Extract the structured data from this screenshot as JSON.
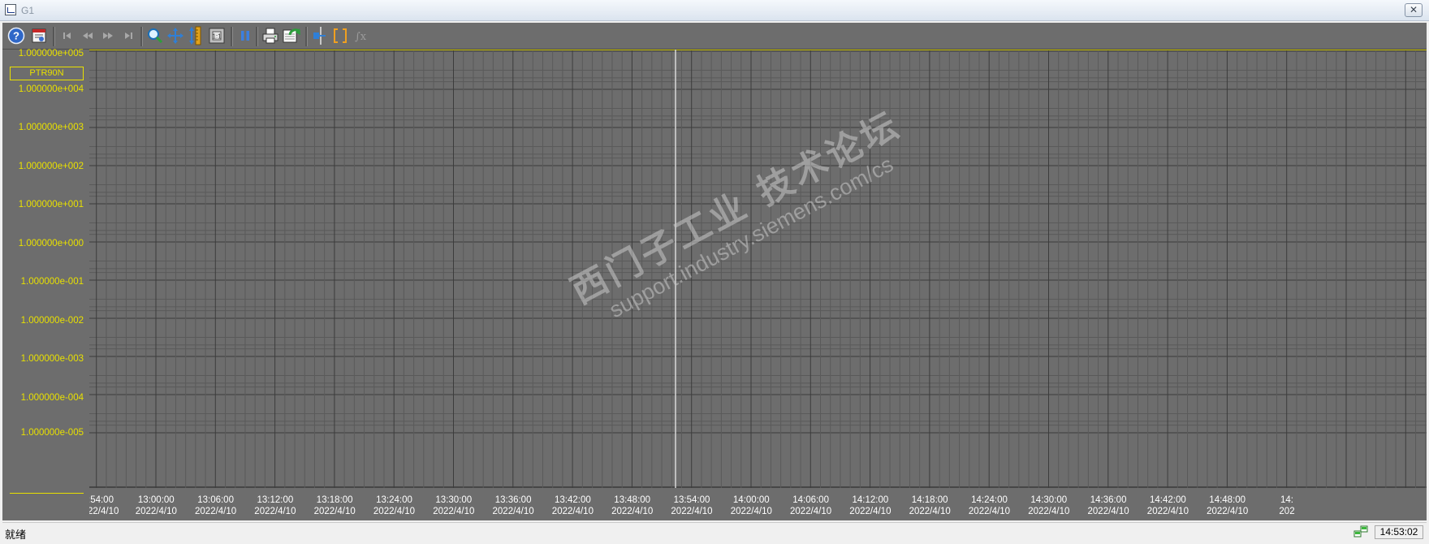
{
  "window": {
    "title": "G1",
    "close_glyph": "✕"
  },
  "toolbar": {
    "buttons": [
      {
        "name": "help-icon"
      },
      {
        "name": "config-icon"
      },
      {
        "name": "first-icon"
      },
      {
        "name": "prev-icon"
      },
      {
        "name": "next-icon"
      },
      {
        "name": "last-icon"
      },
      {
        "name": "zoom-icon"
      },
      {
        "name": "pan-icon"
      },
      {
        "name": "ruler-icon"
      },
      {
        "name": "original-view-icon"
      },
      {
        "name": "pause-icon"
      },
      {
        "name": "print-icon"
      },
      {
        "name": "export-icon"
      },
      {
        "name": "cursor-icon"
      },
      {
        "name": "brackets-icon"
      },
      {
        "name": "statistics-icon"
      }
    ]
  },
  "trace": {
    "name": "PTR90N",
    "color": "#e8e000"
  },
  "y_axis": {
    "scale": "log",
    "labels": [
      "1.000000e+005",
      "1.000000e+004",
      "1.000000e+003",
      "1.000000e+002",
      "1.000000e+001",
      "1.000000e+000",
      "1.000000e-001",
      "1.000000e-002",
      "1.000000e-003",
      "1.000000e-004",
      "1.000000e-005"
    ]
  },
  "x_axis": {
    "ticks": [
      {
        "time": ":54:00",
        "date": "22/4/10"
      },
      {
        "time": "13:00:00",
        "date": "2022/4/10"
      },
      {
        "time": "13:06:00",
        "date": "2022/4/10"
      },
      {
        "time": "13:12:00",
        "date": "2022/4/10"
      },
      {
        "time": "13:18:00",
        "date": "2022/4/10"
      },
      {
        "time": "13:24:00",
        "date": "2022/4/10"
      },
      {
        "time": "13:30:00",
        "date": "2022/4/10"
      },
      {
        "time": "13:36:00",
        "date": "2022/4/10"
      },
      {
        "time": "13:42:00",
        "date": "2022/4/10"
      },
      {
        "time": "13:48:00",
        "date": "2022/4/10"
      },
      {
        "time": "13:54:00",
        "date": "2022/4/10"
      },
      {
        "time": "14:00:00",
        "date": "2022/4/10"
      },
      {
        "time": "14:06:00",
        "date": "2022/4/10"
      },
      {
        "time": "14:12:00",
        "date": "2022/4/10"
      },
      {
        "time": "14:18:00",
        "date": "2022/4/10"
      },
      {
        "time": "14:24:00",
        "date": "2022/4/10"
      },
      {
        "time": "14:30:00",
        "date": "2022/4/10"
      },
      {
        "time": "14:36:00",
        "date": "2022/4/10"
      },
      {
        "time": "14:42:00",
        "date": "2022/4/10"
      },
      {
        "time": "14:48:00",
        "date": "2022/4/10"
      },
      {
        "time": "14:",
        "date": "202"
      }
    ]
  },
  "chart_data": {
    "type": "line",
    "series": [],
    "y_scale": "log",
    "ylim": [
      1e-05,
      100000
    ],
    "grid": true,
    "legend": "top-left"
  },
  "watermark": {
    "line1": "西门子工业 技术论坛",
    "line2": "support.industry.siemens.com/cs"
  },
  "status": {
    "text": "就绪",
    "clock": "14:53:02"
  },
  "colors": {
    "plot_bg": "#6d6d6d",
    "grid": "#3c3c3c",
    "axis_label": "#e8e000",
    "cursor_line": "#d8d8d8"
  }
}
